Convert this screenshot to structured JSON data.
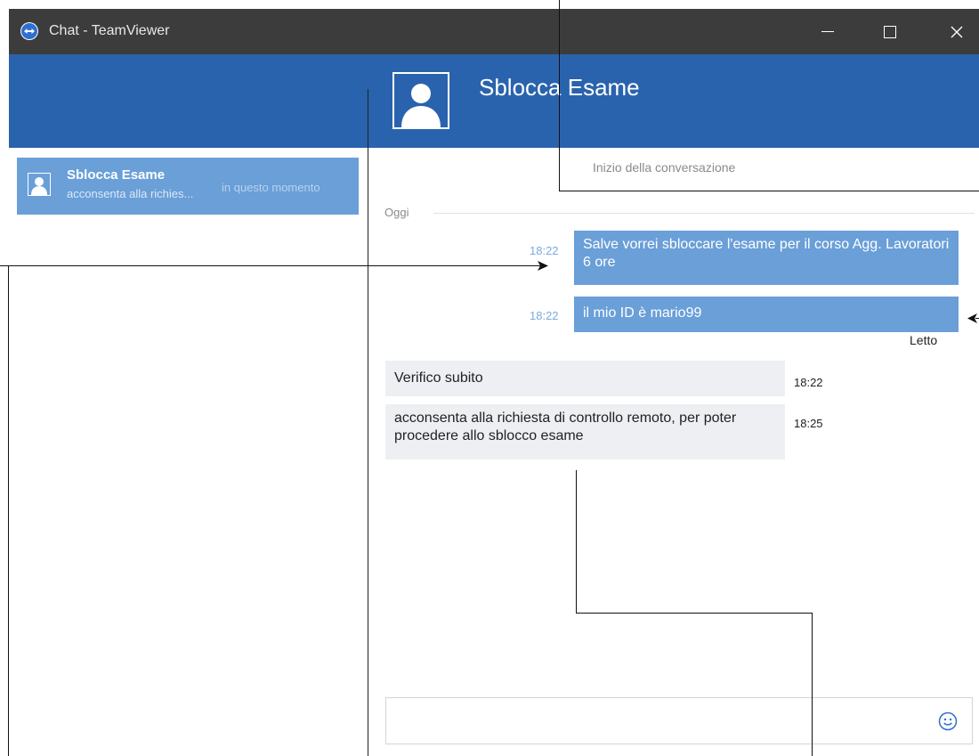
{
  "window": {
    "title": "Chat - TeamViewer",
    "controls": [
      "minimize",
      "maximize",
      "close"
    ]
  },
  "header": {
    "chat_title": "Sblocca Esame",
    "avatar_icon": "user-silhouette-icon"
  },
  "sidebar": {
    "conversations": [
      {
        "name": "Sblocca Esame",
        "preview": "acconsenta alla richies...",
        "time": "in questo momento",
        "selected": true
      }
    ]
  },
  "chat": {
    "conversation_start": "Inizio della conversazione",
    "day_label": "Oggi",
    "messages": [
      {
        "direction": "out",
        "time": "18:22",
        "text": "Salve vorrei sbloccare l'esame per il corso Agg. Lavoratori 6 ore"
      },
      {
        "direction": "out",
        "time": "18:22",
        "text": "il mio ID è mario99"
      },
      {
        "direction": "in",
        "time": "18:22",
        "text": "Verifico subito"
      },
      {
        "direction": "in",
        "time": "18:25",
        "text": "acconsenta alla richiesta di controllo remoto, per poter procedere allo sblocco esame"
      }
    ],
    "read_receipt": "Letto",
    "compose": {
      "value": "",
      "placeholder": ""
    },
    "emoji_icon": "smiley-icon"
  },
  "colors": {
    "titlebar": "#3c3c3c",
    "header": "#2a63ad",
    "selected_item": "#6a9fd8",
    "outgoing_bubble": "#6a9fd8",
    "incoming_bubble": "#eeeff3"
  }
}
